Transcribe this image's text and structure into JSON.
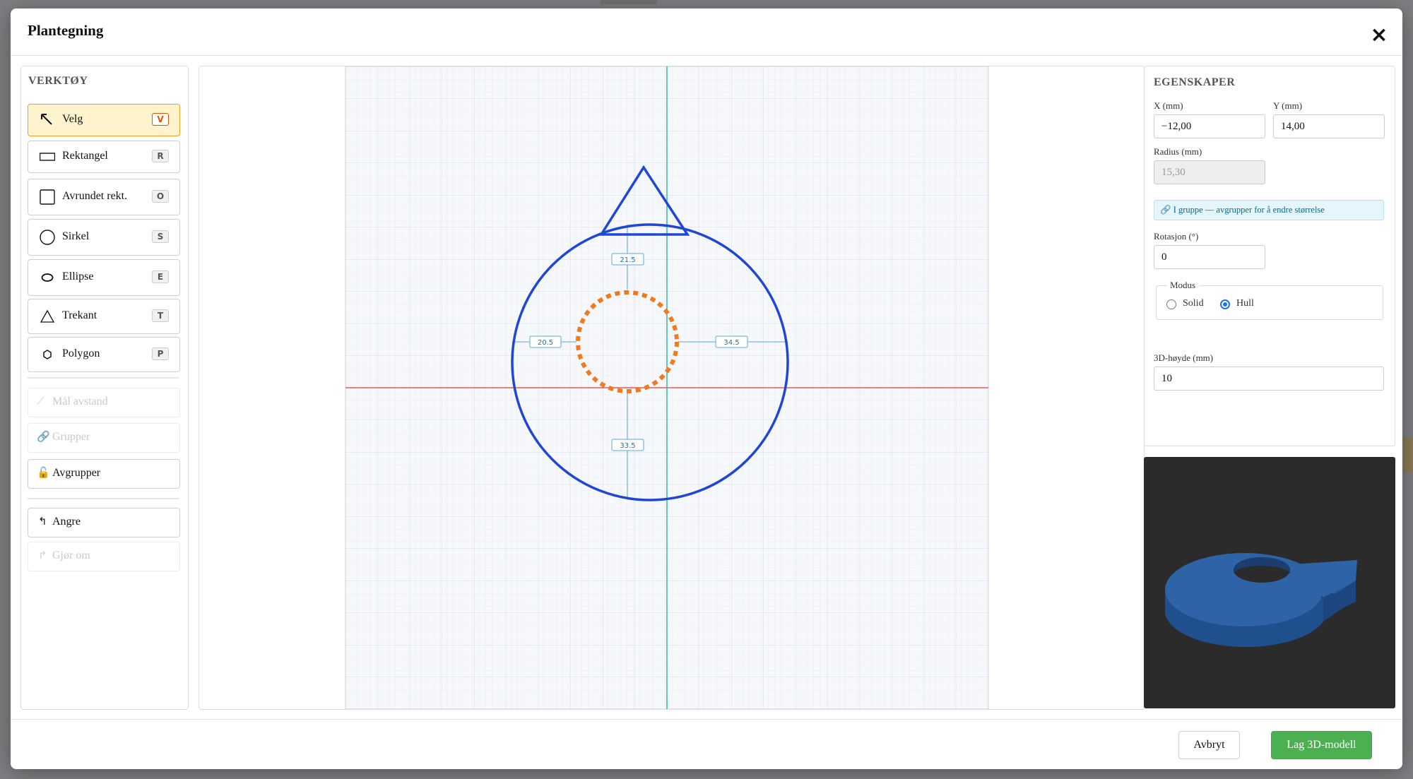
{
  "dialog": {
    "title": "Plantegning",
    "cancel_label": "Avbryt",
    "primary_label": "Lag 3D-modell"
  },
  "tools": {
    "title": "VERKTØY",
    "items": [
      {
        "label": "Velg",
        "key": "V",
        "active": true
      },
      {
        "label": "Rektangel",
        "key": "R"
      },
      {
        "label": "Avrundet rekt.",
        "key": "O"
      },
      {
        "label": "Sirkel",
        "key": "S"
      },
      {
        "label": "Ellipse",
        "key": "E"
      },
      {
        "label": "Trekant",
        "key": "T"
      },
      {
        "label": "Polygon",
        "key": "P"
      }
    ],
    "actions": {
      "measure": "Mål avstand",
      "group": "Grupper",
      "ungroup": "Avgrupper",
      "undo": "Angre",
      "redo": "Gjør om"
    }
  },
  "canvas": {
    "dimensions": {
      "top": "21.5",
      "left": "20.5",
      "right": "34.5",
      "bottom": "33.5"
    },
    "colors": {
      "shape": "#1f47d6",
      "hole": "#f07a1e",
      "x_axis": "#e53935",
      "y_axis": "#1abc9c",
      "dimension": "#5aa8d8"
    }
  },
  "properties": {
    "title": "EGENSKAPER",
    "x_label": "X (mm)",
    "x_value": "−12,00",
    "y_label": "Y (mm)",
    "y_value": "14,00",
    "radius_label": "Radius (mm)",
    "radius_value": "15,30",
    "group_info": "🔗 I gruppe — avgrupper for å endre størrelse",
    "rotation_label": "Rotasjon (°)",
    "rotation_value": "0",
    "mode_legend": "Modus",
    "mode_options": [
      "Solid",
      "Hull"
    ],
    "mode_selected": "Hull",
    "height_label": "3D-høyde (mm)",
    "height_value": "10"
  },
  "preview": {
    "color": "#2f63a8"
  }
}
